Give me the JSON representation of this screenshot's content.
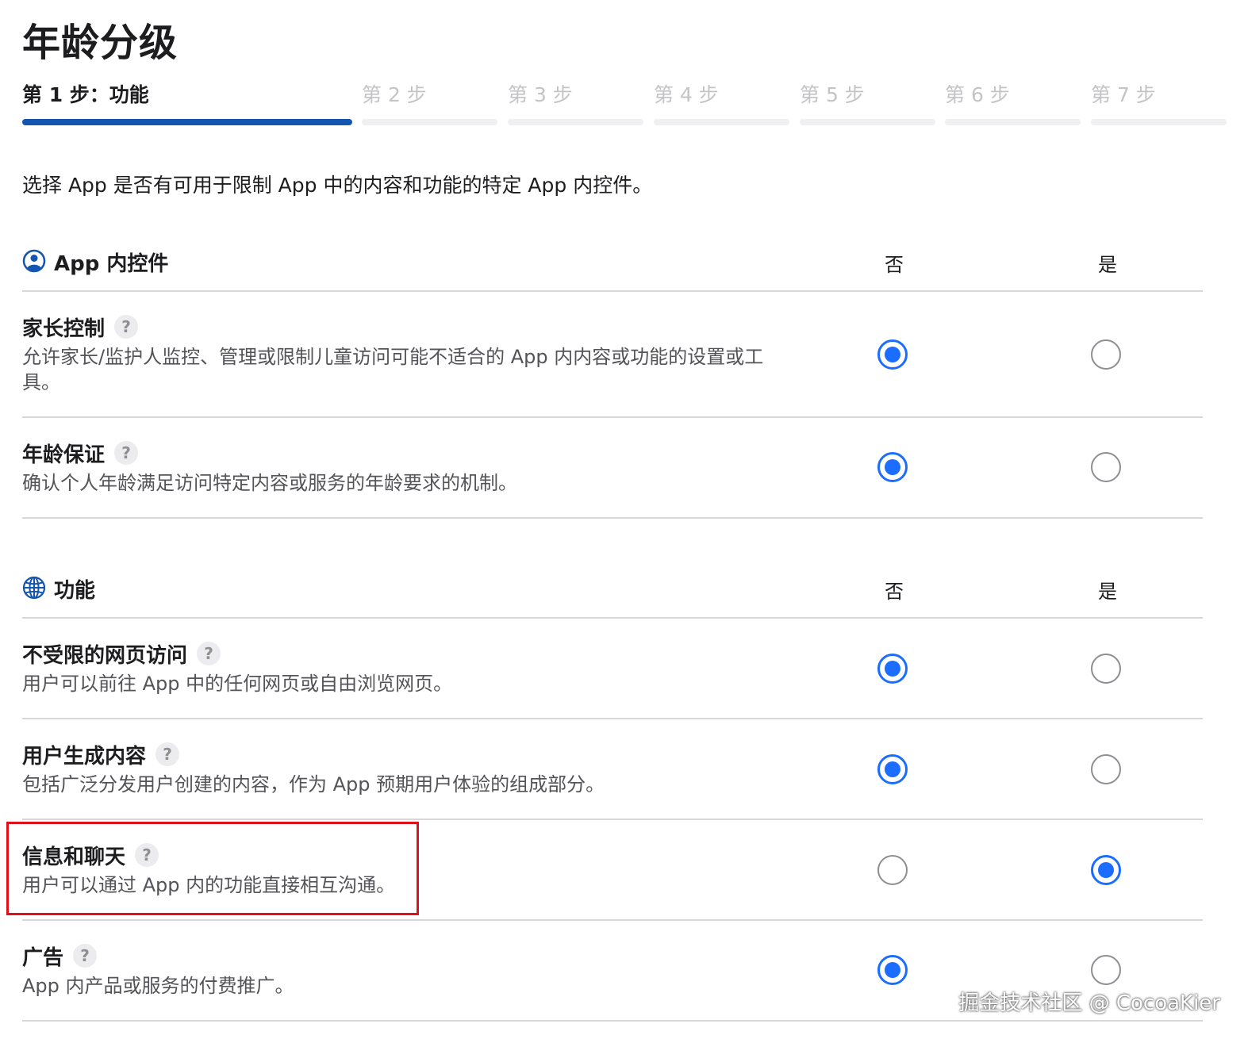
{
  "page": {
    "title": "年龄分级"
  },
  "stepper": {
    "steps": [
      {
        "label": "第 1 步：功能",
        "active": true
      },
      {
        "label": "第 2 步",
        "active": false
      },
      {
        "label": "第 3 步",
        "active": false
      },
      {
        "label": "第 4 步",
        "active": false
      },
      {
        "label": "第 5 步",
        "active": false
      },
      {
        "label": "第 6 步",
        "active": false
      },
      {
        "label": "第 7 步",
        "active": false
      }
    ]
  },
  "intro": "选择 App 是否有可用于限制 App 中的内容和功能的特定 App 内控件。",
  "sections": [
    {
      "title": "App 内控件",
      "icon": "person-circle-icon",
      "col_no": "否",
      "col_yes": "是",
      "rows": [
        {
          "title": "家长控制",
          "help": "?",
          "desc": "允许家长/监护人监控、管理或限制儿童访问可能不适合的 App 内内容或功能的设置或工具。",
          "selected": "no"
        },
        {
          "title": "年龄保证",
          "help": "?",
          "desc": "确认个人年龄满足访问特定内容或服务的年龄要求的机制。",
          "selected": "no"
        }
      ]
    },
    {
      "title": "功能",
      "icon": "globe-icon",
      "col_no": "否",
      "col_yes": "是",
      "rows": [
        {
          "title": "不受限的网页访问",
          "help": "?",
          "desc": "用户可以前往 App 中的任何网页或自由浏览网页。",
          "selected": "no"
        },
        {
          "title": "用户生成内容",
          "help": "?",
          "desc": "包括广泛分发用户创建的内容，作为 App 预期用户体验的组成部分。",
          "selected": "no"
        },
        {
          "title": "信息和聊天",
          "help": "?",
          "desc": "用户可以通过 App 内的功能直接相互沟通。",
          "selected": "yes"
        },
        {
          "title": "广告",
          "help": "?",
          "desc": "App 内产品或服务的付费推广。",
          "selected": "no"
        }
      ]
    }
  ],
  "watermark": "掘金技术社区 @ CocoaKier",
  "colors": {
    "accent": "#1455b0",
    "radio": "#1a6dff",
    "highlight": "#e0101a"
  }
}
